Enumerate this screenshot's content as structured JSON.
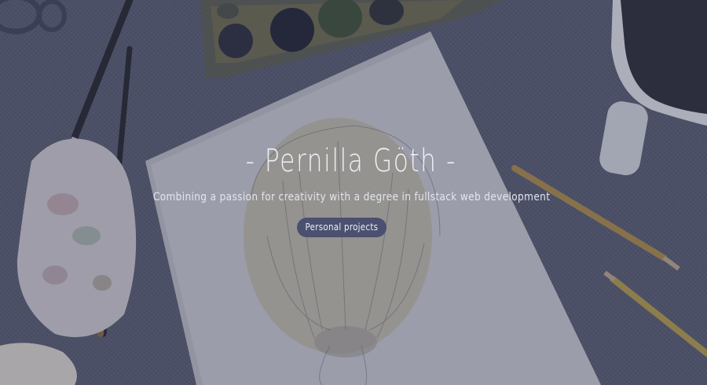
{
  "hero": {
    "title": "- Pernilla Göth -",
    "subtitle": "Combining a passion for creativity with a degree in fullstack web development",
    "cta_label": "Personal projects"
  },
  "colors": {
    "overlay": "#2d3250",
    "text": "#eef0f6",
    "button_bg": "#4b5070"
  }
}
